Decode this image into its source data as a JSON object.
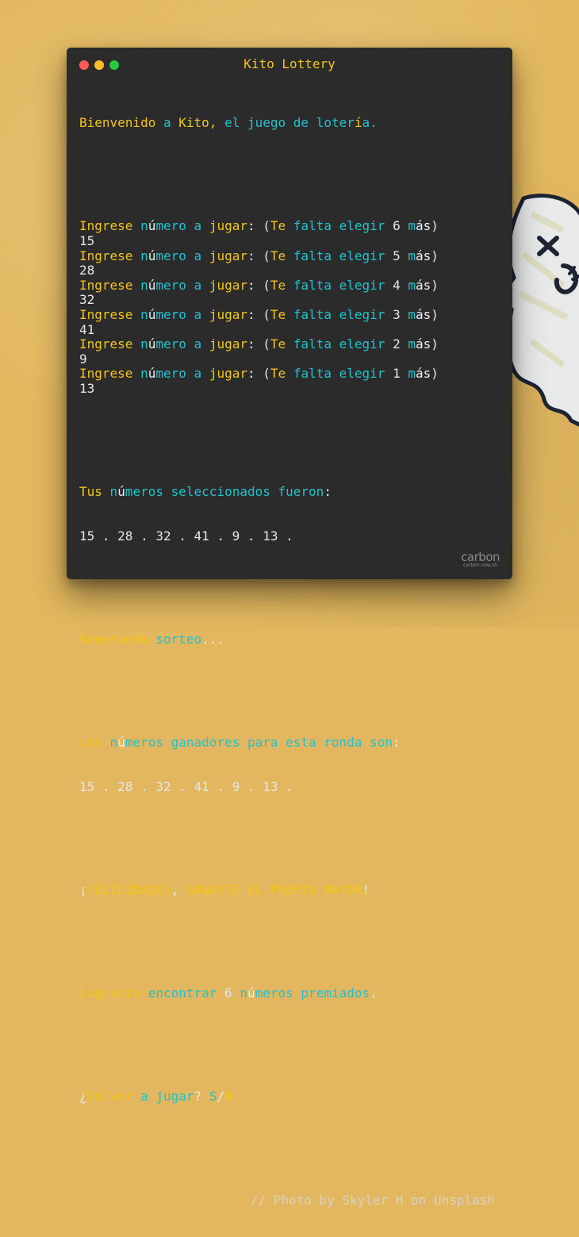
{
  "window": {
    "title": "Kito Lottery"
  },
  "terminal": {
    "welcome": {
      "bienvenido": "Bienvenido",
      "a1": "a",
      "kito": "Kito,",
      "el": "el",
      "juego": "juego",
      "de": "de",
      "lot": "loter",
      "i": "í",
      "a2": "a."
    },
    "prompts": [
      {
        "remaining": "6",
        "answer": "15"
      },
      {
        "remaining": "5",
        "answer": "28"
      },
      {
        "remaining": "4",
        "answer": "32"
      },
      {
        "remaining": "3",
        "answer": "41"
      },
      {
        "remaining": "2",
        "answer": "9"
      },
      {
        "remaining": "1",
        "answer": "13"
      }
    ],
    "prompt_words": {
      "ingrese": "Ingrese",
      "n": "n",
      "u": "ú",
      "mero": "mero",
      "a": "a",
      "jugar": "jugar",
      "colon": ":",
      "paren_open": "(",
      "te": "Te",
      "falta": "falta",
      "elegir": "elegir",
      "m": "m",
      "as": "ás",
      "paren_close": ")"
    },
    "selected": {
      "tus": "Tus",
      "n": "n",
      "u": "ú",
      "meros": "meros",
      "seleccionados": "seleccionados",
      "fueron": "fueron",
      "colon": ":",
      "numbers": "15 . 28 . 32 . 41 . 9 . 13 ."
    },
    "generating": {
      "generando": "Generando",
      "sorteo": "sorteo",
      "dots": "..."
    },
    "winning": {
      "los": "Los",
      "n": "n",
      "u": "ú",
      "meros": "meros",
      "ganadores": "ganadores",
      "para": "para",
      "esta": "esta",
      "ronda": "ronda",
      "son": "son",
      "colon": ":",
      "numbers": "15 . 28 . 32 . 41 . 9 . 13 ."
    },
    "congrats": {
      "open": "¡",
      "felicidades": "FELICIDADES",
      "comma": ",",
      "ganaste": "GANASTE EL PREMIO MAYOR",
      "close": "!"
    },
    "result": {
      "lograste": "Lograste",
      "encontrar": "encontrar",
      "count": "6",
      "n": "n",
      "u": "ú",
      "meros": "meros",
      "premiados": "premiados",
      "period": "."
    },
    "again": {
      "open": "¿",
      "volver": "Volver",
      "a": "a",
      "jugar": "jugar",
      "q": "?",
      "s": "S",
      "slash": "/",
      "n": "N"
    },
    "credit": "// Photo by Skyler H on Unsplash"
  },
  "watermark": {
    "logo": "carbon",
    "url": "carbon.now.sh"
  },
  "colors": {
    "yellow": "#f5c518",
    "cyan": "#20c3d0",
    "background": "#2b2b2b",
    "wall": "#e2b75f"
  }
}
